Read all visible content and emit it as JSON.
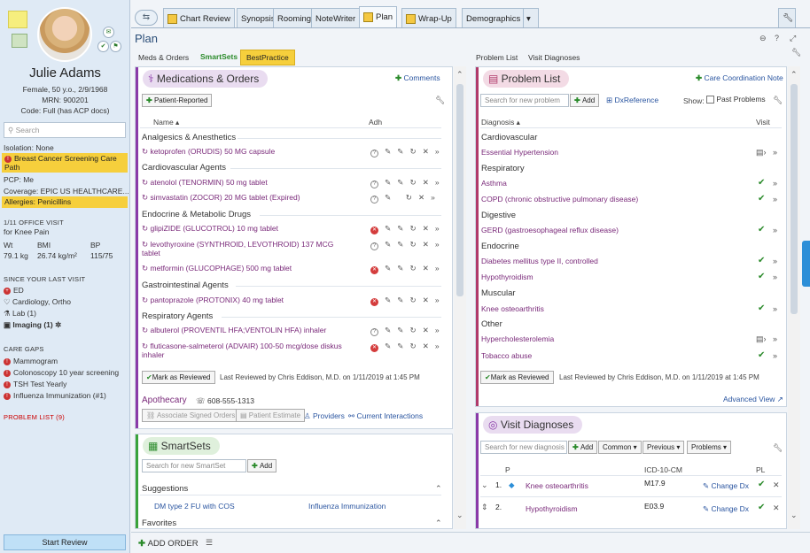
{
  "patient": {
    "name": "Julie Adams",
    "demo": "Female, 50 y.o., 2/9/1968",
    "mrn": "MRN: 900201",
    "code": "Code: Full (has ACP docs)",
    "search_placeholder": "Search",
    "isolation": "Isolation: None",
    "care_path": "Breast Cancer Screening Care Path",
    "pcp": "PCP: Me",
    "coverage": "Coverage: EPIC US HEALTHCARE...",
    "allergies": "Allergies: Penicillins",
    "visit_label": "1/11 OFFICE VISIT",
    "visit_reason": "for Knee Pain",
    "vitals_headers": [
      "Wt",
      "BMI",
      "BP"
    ],
    "vitals_values": [
      "79.1 kg",
      "26.74 kg/m²",
      "115/75"
    ],
    "since_label": "SINCE YOUR LAST VISIT",
    "since_items": [
      "ED",
      "Cardiology, Ortho",
      "Lab (1)",
      "Imaging (1)"
    ],
    "care_gaps_label": "CARE GAPS",
    "care_gaps": [
      "Mammogram",
      "Colonoscopy 10 year screening",
      "TSH Test Yearly",
      "Influenza Immunization (#1)"
    ],
    "problem_list_link": "PROBLEM LIST (9)",
    "start_review": "Start Review"
  },
  "tabs": [
    "Chart Review",
    "Synopsis",
    "Rooming",
    "NoteWriter",
    "Plan",
    "Wrap-Up",
    "Demographics"
  ],
  "active_tab": "Plan",
  "page_title": "Plan",
  "subnav_left": [
    "Meds & Orders",
    "SmartSets",
    "BestPractice"
  ],
  "subnav_right": [
    "Problem List",
    "Visit Diagnoses"
  ],
  "meds": {
    "title": "Medications & Orders",
    "comments": "Comments",
    "patient_reported": "Patient-Reported",
    "col_name": "Name ▴",
    "col_adh": "Adh",
    "groups": [
      {
        "name": "Analgesics & Anesthetics",
        "items": [
          "ketoprofen (ORUDIS) 50 MG capsule"
        ]
      },
      {
        "name": "Cardiovascular Agents",
        "items": [
          "atenolol (TENORMIN) 50 mg tablet",
          "simvastatin (ZOCOR) 20 MG tablet (Expired)"
        ]
      },
      {
        "name": "Endocrine & Metabolic Drugs",
        "items": [
          "glipiZIDE (GLUCOTROL) 10 mg tablet",
          "levothyroxine (SYNTHROID, LEVOTHROID) 137 MCG tablet",
          "metformin (GLUCOPHAGE) 500 mg tablet"
        ]
      },
      {
        "name": "Gastrointestinal Agents",
        "items": [
          "pantoprazole (PROTONIX) 40 mg tablet"
        ]
      },
      {
        "name": "Respiratory Agents",
        "items": [
          "albuterol (PROVENTIL HFA;VENTOLIN HFA) inhaler",
          "fluticasone-salmeterol (ADVAIR) 100-50 mcg/dose diskus inhaler"
        ]
      }
    ],
    "mark_reviewed": "Mark as Reviewed",
    "last_reviewed": "Last Reviewed by Chris Eddison, M.D. on 1/11/2019 at 1:45 PM",
    "pharmacy": "Apothecary",
    "phone": "608-555-1313",
    "assoc": "Associate Signed Orders",
    "estimate": "Patient Estimate",
    "providers": "Providers",
    "interactions": "Current Interactions"
  },
  "smartsets": {
    "title": "SmartSets",
    "search_placeholder": "Search for new SmartSet",
    "add": "Add",
    "suggestions": "Suggestions",
    "items": [
      "DM type 2 FU with COS",
      "Influenza Immunization"
    ],
    "favorites": "Favorites"
  },
  "problems": {
    "title": "Problem List",
    "care_note": "Care Coordination Note",
    "search_placeholder": "Search for new problem",
    "add": "Add",
    "dx_ref": "DxReference",
    "show": "Show:",
    "past": "Past Problems",
    "col_dx": "Diagnosis ▴",
    "col_visit": "Visit",
    "groups": [
      {
        "name": "Cardiovascular",
        "items": [
          "Essential Hypertension"
        ]
      },
      {
        "name": "Respiratory",
        "items": [
          "Asthma",
          "COPD (chronic obstructive pulmonary disease)"
        ]
      },
      {
        "name": "Digestive",
        "items": [
          "GERD (gastroesophageal reflux disease)"
        ]
      },
      {
        "name": "Endocrine",
        "items": [
          "Diabetes mellitus type II, controlled",
          "Hypothyroidism"
        ]
      },
      {
        "name": "Muscular",
        "items": [
          "Knee osteoarthritis"
        ]
      },
      {
        "name": "Other",
        "items": [
          "Hypercholesterolemia",
          "Tobacco abuse"
        ]
      }
    ],
    "mark_reviewed": "Mark as Reviewed",
    "last_reviewed": "Last Reviewed by Chris Eddison, M.D. on 1/11/2019 at 1:45 PM",
    "advanced": "Advanced View"
  },
  "visit_dx": {
    "title": "Visit Diagnoses",
    "search_placeholder": "Search for new diagnosis",
    "add": "Add",
    "common": "Common",
    "previous": "Previous",
    "problems": "Problems",
    "col_p": "P",
    "col_icd": "ICD-10-CM",
    "col_pl": "PL",
    "rows": [
      {
        "num": "1.",
        "name": "Knee osteoarthritis",
        "code": "M17.9",
        "action": "Change Dx"
      },
      {
        "num": "2.",
        "name": "Hypothyroidism",
        "code": "E03.9",
        "action": "Change Dx"
      }
    ]
  },
  "add_order": "ADD ORDER",
  "colors": {
    "accent": "#8a3aa8",
    "green": "#2a8a2a",
    "highlight": "#f6cf3c"
  }
}
